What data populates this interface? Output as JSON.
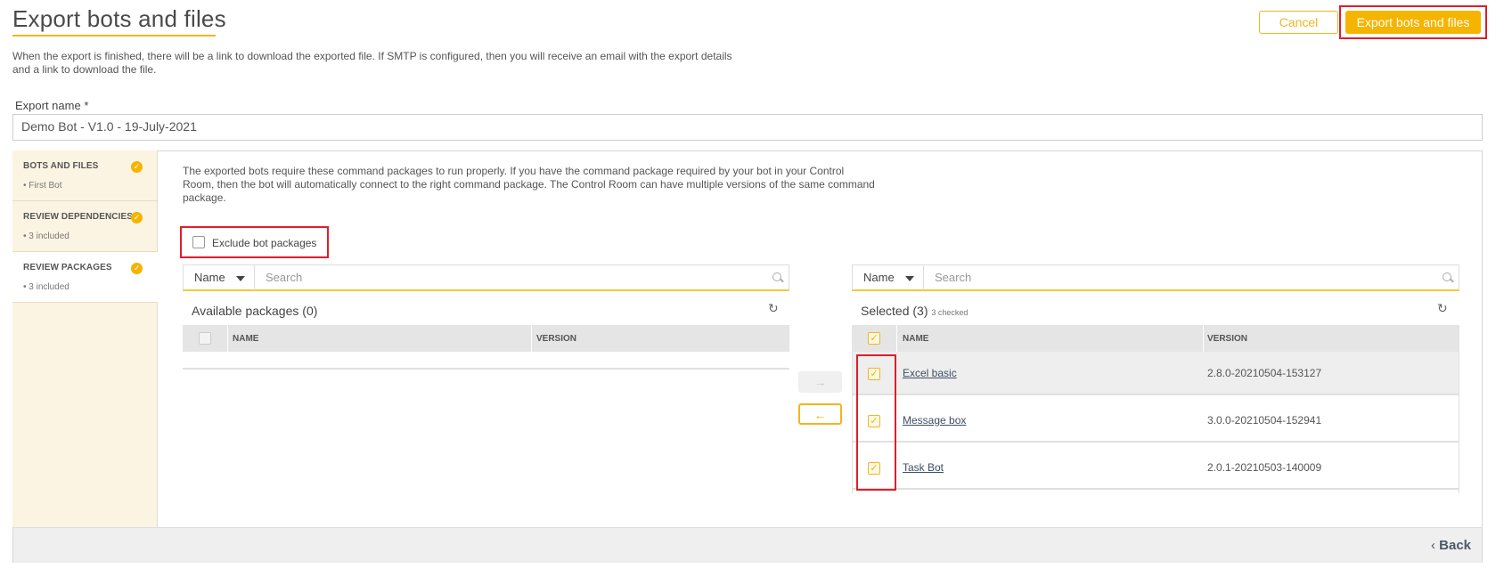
{
  "page": {
    "title": "Export bots and files",
    "description": "When the export is finished, there will be a link to download the exported file. If SMTP is configured, then you will receive an email with the export details and a link to download the file."
  },
  "header": {
    "cancel_label": "Cancel",
    "export_label": "Export bots and files"
  },
  "export_name": {
    "label": "Export name *",
    "value": "Demo Bot - V1.0 - 19-July-2021"
  },
  "sidebar": {
    "items": [
      {
        "title": "BOTS AND FILES",
        "sub": "• First Bot"
      },
      {
        "title": "REVIEW DEPENDENCIES",
        "sub": "• 3 included"
      },
      {
        "title": "REVIEW PACKAGES",
        "sub": "• 3 included"
      }
    ]
  },
  "main": {
    "info": "The exported bots require these command packages to run properly. If you have the command package required by your bot in your Control Room, then the bot will automatically connect to the right command package. The Control Room can have multiple versions of the same command package.",
    "exclude_label": "Exclude bot packages"
  },
  "available": {
    "filter_label": "Name",
    "search_placeholder": "Search",
    "title": "Available packages",
    "count": "(0)",
    "col_name": "NAME",
    "col_version": "VERSION"
  },
  "selected": {
    "filter_label": "Name",
    "search_placeholder": "Search",
    "title": "Selected",
    "count": "(3)",
    "checked": "3 checked",
    "col_name": "NAME",
    "col_version": "VERSION",
    "rows": [
      {
        "name": "Excel basic",
        "version": "2.8.0-20210504-153127"
      },
      {
        "name": "Message box",
        "version": "3.0.0-20210504-152941"
      },
      {
        "name": "Task Bot",
        "version": "2.0.1-20210503-140009"
      }
    ]
  },
  "transfer": {
    "right_arrow": "→",
    "left_arrow": "←"
  },
  "footer": {
    "back_label": "Back"
  },
  "colors": {
    "accent": "#f5b400",
    "highlight": "#e01d2a"
  }
}
